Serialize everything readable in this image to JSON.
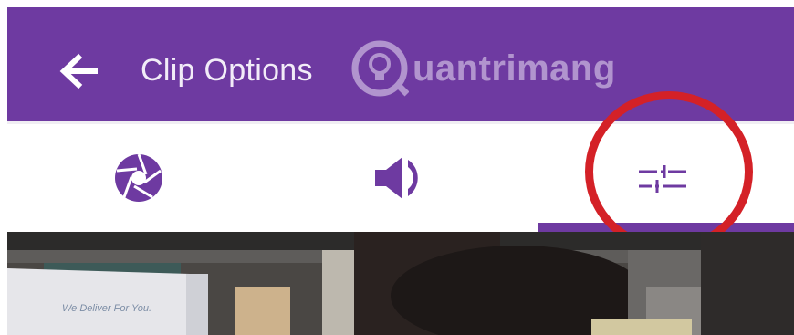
{
  "header": {
    "title": "Clip Options",
    "watermark": "uantrimang",
    "back_icon": "arrow-left-icon",
    "background_color": "#6e3aa1"
  },
  "tabs": [
    {
      "icon": "aperture-icon",
      "selected": false
    },
    {
      "icon": "volume-icon",
      "selected": false
    },
    {
      "icon": "sliders-icon",
      "selected": true
    }
  ],
  "accent_color": "#6e3aa1",
  "annotation_color": "#d42127",
  "preview": {
    "truck_text": "We Deliver For You."
  }
}
